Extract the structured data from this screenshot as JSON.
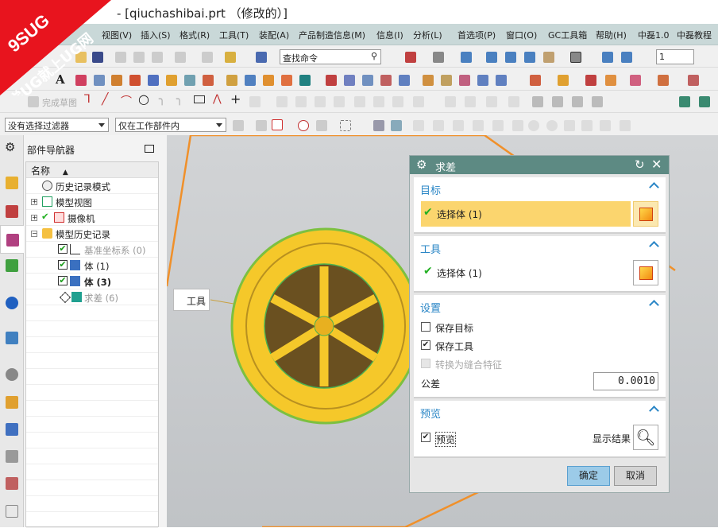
{
  "window": {
    "title": "- [qiuchashibai.prt （修改的）]",
    "watermark": "9SUG 学UG就上UG网"
  },
  "menu": [
    "视图(V)",
    "插入(S)",
    "格式(R)",
    "工具(T)",
    "装配(A)",
    "产品制造信息(M)",
    "信息(I)",
    "分析(L)",
    "首选项(P)",
    "窗口(O)",
    "GC工具箱",
    "帮助(H)",
    "中磊1.0",
    "中磊教程"
  ],
  "toolbar": {
    "search_placeholder": "查找命令",
    "finish_sketch": "完成草图",
    "layer_value": "1",
    "filter": "没有选择过滤器",
    "scope": "仅在工作部件内"
  },
  "navigator": {
    "title": "部件导航器",
    "column": "名称",
    "items": [
      {
        "label": "历史记录模式"
      },
      {
        "label": "模型视图"
      },
      {
        "label": "摄像机"
      },
      {
        "label": "模型历史记录"
      },
      {
        "label": "基准坐标系 (0)"
      },
      {
        "label": "体 (1)"
      },
      {
        "label": "体 (3)"
      },
      {
        "label": "求差 (6)"
      }
    ]
  },
  "viewport": {
    "tool_label": "工具"
  },
  "dialog": {
    "title": "求差",
    "target": {
      "header": "目标",
      "select": "选择体 (1)"
    },
    "tool": {
      "header": "工具",
      "select": "选择体 (1)"
    },
    "settings": {
      "header": "设置",
      "keep_target": "保存目标",
      "keep_tool": "保存工具",
      "convert": "转换为缝合特征",
      "tolerance_label": "公差",
      "tolerance_value": "0.0010"
    },
    "preview": {
      "header": "预览",
      "preview": "预览",
      "show_result": "显示结果"
    },
    "ok": "确定",
    "cancel": "取消"
  },
  "colors": {
    "dialog_header": "#5d8a83",
    "accent": "#2a86c6",
    "selected_row": "#fbd56e",
    "wheel": "#f5c82a",
    "ok_button": "#9ccbe8"
  }
}
